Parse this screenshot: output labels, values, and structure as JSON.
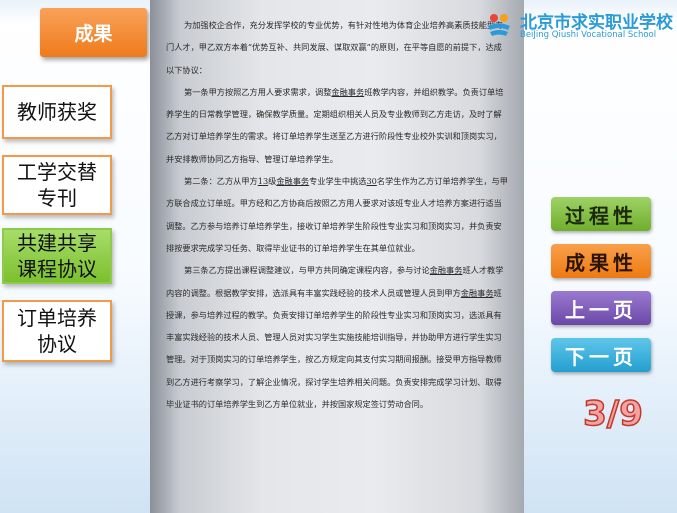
{
  "header": {
    "section_title": "成果"
  },
  "logo": {
    "name_cn": "北京市求实职业学校",
    "name_en": "BeiJing Qiushi Vocational School"
  },
  "sidebar": {
    "items": [
      {
        "label": "教师获奖"
      },
      {
        "label": "工学交替专刊"
      },
      {
        "label": "共建共享课程协议"
      },
      {
        "label": "订单培养协议"
      }
    ]
  },
  "document": {
    "p1a": "为加强校企合作，充分发挥学校的专业优势，有针对性地为体育企业培养高素质技能型专门人才，甲乙双方本着“优势互补、共同发展、谋取双赢”的原则，在平等自愿的前提下，达成以下协议：",
    "c1_pre": "第一条甲方按照乙方用人要求需求，调整",
    "c1_u": "金融事务",
    "c1_post": "班教学内容，并组织教学。负责订单培养学生的日常教学管理，确保教学质量。定期组织相关人员及专业教师到乙方走访，及时了解乙方对订单培养学生的需求。将订单培养学生送至乙方进行阶段性专业校外实训和顶岗实习，并安排教师协同乙方指导、管理订单培养学生。",
    "c2_pre": "第二条：乙方从甲方",
    "c2_u1": "13",
    "c2_mid1": "级",
    "c2_u2": "金融事务",
    "c2_mid2": "专业学生中挑选",
    "c2_u3": "30",
    "c2_post": "名学生作为乙方订单培养学生，与甲方联合成立订单班。甲方经和乙方协商后按照乙方用人要求对该班专业人才培养方案进行适当调整。乙方参与培养订单培养学生，接收订单培养学生阶段性专业实习和顶岗实习，并负责安排按要求完成学习任务、取得毕业证书的订单培养学生在其单位就业。",
    "c3_pre": "第三条乙方提出课程调整建议，与甲方共同确定课程内容，参与讨论",
    "c3_u1": "金融事务",
    "c3_mid": "班人才教学内容的调整。根据教学安排，选派具有丰富实践经验的技术人员或管理人员到甲方",
    "c3_u2": "金融事务",
    "c3_post": "班授课，参与培养过程的教学。负责安排订单培养学生的阶段性专业实习和顶岗实习，选派具有丰富实践经验的技术人员、管理人员对实习学生实施技能培训指导，并协助甲方进行学生实习管理。对于顶岗实习的订单培养学生，按乙方规定向其支付实习期间报酬。接受甲方指导教师到乙方进行考察学习，了解企业情况，探讨学生培养相关问题。负责安排完成学习计划、取得毕业证书的订单培养学生到乙方单位就业，并按国家规定签订劳动合同。"
  },
  "buttons": {
    "process": "过程性",
    "outcome": "成果性",
    "prev": "上一页",
    "next": "下一页"
  },
  "pagination": {
    "text": "3/9"
  }
}
